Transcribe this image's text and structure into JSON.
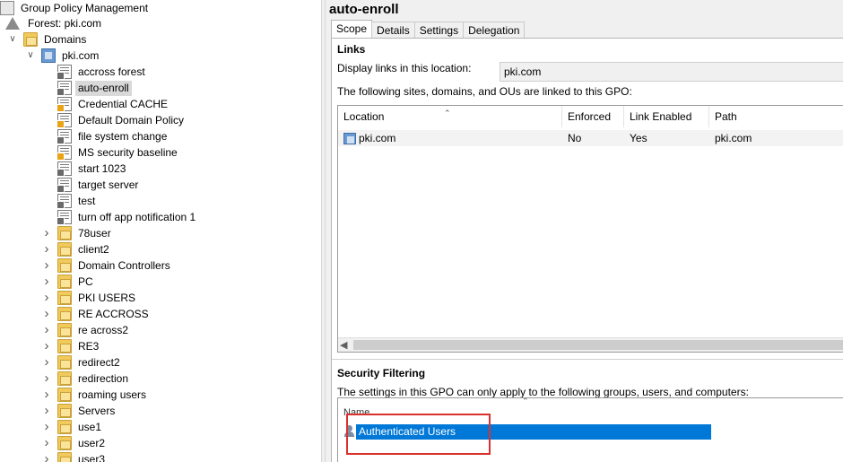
{
  "tree": {
    "root_label": "Group Policy Management",
    "forest_label": "Forest: pki.com",
    "domains_label": "Domains",
    "domain_label": "pki.com",
    "gpos": [
      {
        "label": "accross forest",
        "enforced": false,
        "selected": false
      },
      {
        "label": "auto-enroll",
        "enforced": false,
        "selected": true
      },
      {
        "label": "Credential CACHE",
        "enforced": true,
        "selected": false
      },
      {
        "label": "Default Domain Policy",
        "enforced": true,
        "selected": false
      },
      {
        "label": "file system change",
        "enforced": false,
        "selected": false
      },
      {
        "label": "MS security baseline",
        "enforced": true,
        "selected": false
      },
      {
        "label": "start 1023",
        "enforced": false,
        "selected": false
      },
      {
        "label": "target server",
        "enforced": false,
        "selected": false
      },
      {
        "label": "test",
        "enforced": false,
        "selected": false
      },
      {
        "label": "turn off  app notification 1",
        "enforced": false,
        "selected": false
      }
    ],
    "ous": [
      "78user",
      "client2",
      "Domain Controllers",
      "PC",
      "PKI USERS",
      "RE ACCROSS",
      "re across2",
      "RE3",
      "redirect2",
      "redirection",
      "roaming users",
      "Servers",
      "use1",
      "user2",
      "user3"
    ]
  },
  "panel": {
    "title": "auto-enroll",
    "tabs": [
      "Scope",
      "Details",
      "Settings",
      "Delegation"
    ],
    "active_tab": "Scope",
    "links": {
      "heading": "Links",
      "display_label": "Display links in this location:",
      "display_value": "pki.com",
      "description": "The following sites, domains, and OUs are linked to this GPO:",
      "columns": [
        "Location",
        "Enforced",
        "Link Enabled",
        "Path"
      ],
      "rows": [
        {
          "location": "pki.com",
          "enforced": "No",
          "link_enabled": "Yes",
          "path": "pki.com"
        }
      ]
    },
    "security": {
      "heading": "Security Filtering",
      "description": "The settings in this GPO can only apply to the following groups, users, and computers:",
      "column": "Name",
      "rows": [
        "Authenticated Users"
      ]
    }
  },
  "colors": {
    "selection": "#0078d7",
    "highlight_box": "#d9322e",
    "tree_selected": "#d9d9d9"
  }
}
